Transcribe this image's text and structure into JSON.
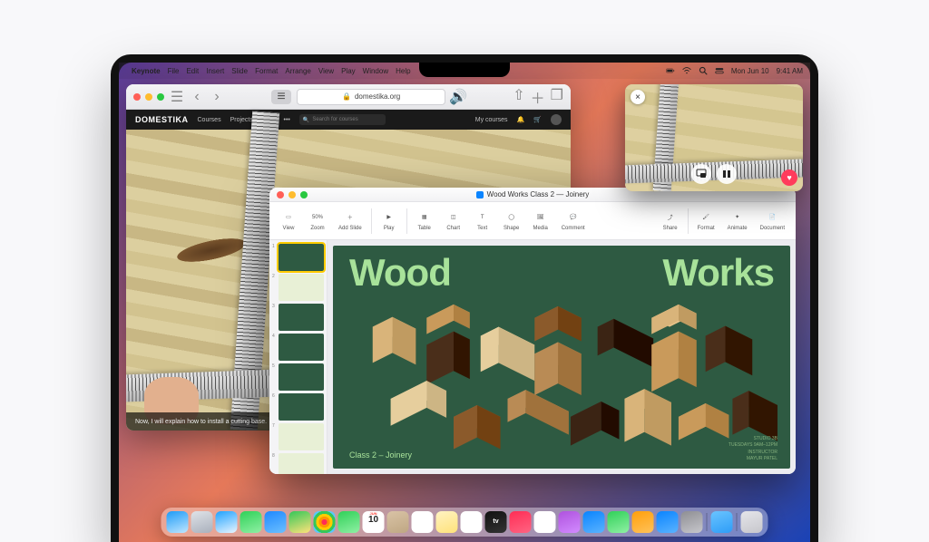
{
  "menubar": {
    "app_name": "Keynote",
    "items": [
      "File",
      "Edit",
      "Insert",
      "Slide",
      "Format",
      "Arrange",
      "View",
      "Play",
      "Window",
      "Help"
    ],
    "date": "Mon Jun 10",
    "time": "9:41 AM"
  },
  "safari": {
    "url": "domestika.org",
    "site": {
      "logo": "DOMESTIKA",
      "nav": [
        "Courses",
        "Projects",
        "Plus",
        "•••"
      ],
      "search_placeholder": "Search for courses",
      "my_courses": "My courses"
    },
    "caption": "Now, I will explain how to install a cutting base."
  },
  "pip": {
    "close": "×",
    "heart": "♥"
  },
  "keynote": {
    "doc_title": "Wood Works Class 2 — Joinery",
    "toolbar": {
      "view": "View",
      "zoom_pct": "50%",
      "zoom": "Zoom",
      "add_slide": "Add Slide",
      "play": "Play",
      "table": "Table",
      "chart": "Chart",
      "text": "Text",
      "shape": "Shape",
      "media": "Media",
      "comment": "Comment",
      "share": "Share",
      "format": "Format",
      "animate": "Animate",
      "document": "Document"
    },
    "slide": {
      "title_left": "Wood",
      "title_right": "Works",
      "subtitle": "Class 2 – Joinery",
      "meta_l1": "STUDIO 3B",
      "meta_l2": "TUESDAYS 9AM–12PM",
      "meta_l3": "INSTRUCTOR",
      "meta_l4": "MAYUR PATEL"
    },
    "slides_count": 8
  },
  "dock": {
    "apps": [
      {
        "name": "finder",
        "c1": "#1e9bf7",
        "c2": "#bfe6ff"
      },
      {
        "name": "launchpad",
        "c1": "#e0e3e8",
        "c2": "#a9b0bc"
      },
      {
        "name": "safari",
        "c1": "#1fa2ff",
        "c2": "#e9f5ff"
      },
      {
        "name": "messages",
        "c1": "#30d158",
        "c2": "#8ff0a4"
      },
      {
        "name": "mail",
        "c1": "#1e88ff",
        "c2": "#6cc0ff"
      },
      {
        "name": "maps",
        "c1": "#34c759",
        "c2": "#ffe27a"
      },
      {
        "name": "photos",
        "c1": "#ffffff",
        "c2": "#ffffff"
      },
      {
        "name": "facetime",
        "c1": "#30d158",
        "c2": "#8ff0a4"
      },
      {
        "name": "calendar",
        "c1": "#ffffff",
        "c2": "#ffffff"
      },
      {
        "name": "contacts",
        "c1": "#d9c3a6",
        "c2": "#bfa783"
      },
      {
        "name": "reminders",
        "c1": "#ffffff",
        "c2": "#ffffff"
      },
      {
        "name": "notes",
        "c1": "#fff3c2",
        "c2": "#ffe27a"
      },
      {
        "name": "freeform",
        "c1": "#ffffff",
        "c2": "#ffffff"
      },
      {
        "name": "tv",
        "c1": "#111111",
        "c2": "#333333"
      },
      {
        "name": "music",
        "c1": "#ff2d55",
        "c2": "#ff6482"
      },
      {
        "name": "news",
        "c1": "#ffffff",
        "c2": "#ffffff"
      },
      {
        "name": "podcasts",
        "c1": "#af52de",
        "c2": "#d28bff"
      },
      {
        "name": "keynote",
        "c1": "#0a84ff",
        "c2": "#5ab3ff"
      },
      {
        "name": "numbers",
        "c1": "#30d158",
        "c2": "#8ff0a4"
      },
      {
        "name": "pages",
        "c1": "#ff9f0a",
        "c2": "#ffc25a"
      },
      {
        "name": "appstore",
        "c1": "#0a84ff",
        "c2": "#5ab3ff"
      },
      {
        "name": "settings",
        "c1": "#8e8e93",
        "c2": "#c7c7cc"
      }
    ],
    "cal_month": "JUN",
    "cal_day": "10",
    "pinned": [
      {
        "name": "folder",
        "c1": "#6ac4ff",
        "c2": "#2e9df7"
      }
    ],
    "trash": {
      "name": "trash",
      "c1": "#e5e5ea",
      "c2": "#c7c7cc"
    }
  }
}
